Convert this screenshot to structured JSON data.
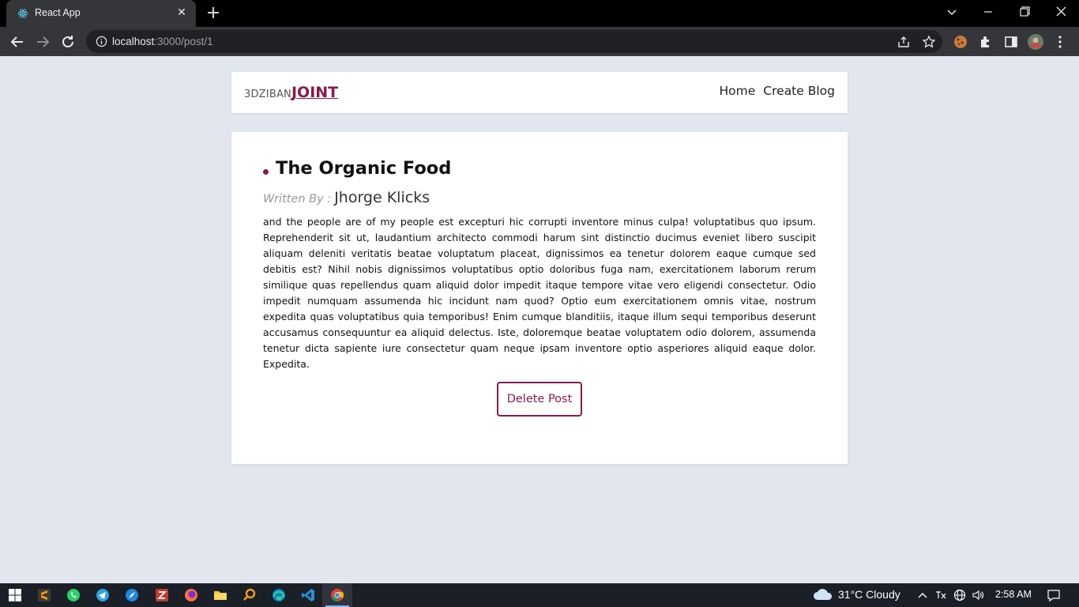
{
  "browser": {
    "tab_title": "React App",
    "url_host": "localhost",
    "url_path": ":3000/post/1"
  },
  "navbar": {
    "brand_prefix": "3DZIBAN",
    "brand_name": "JOINT",
    "links": [
      {
        "label": "Home"
      },
      {
        "label": "Create Blog"
      }
    ]
  },
  "post": {
    "title": "The Organic Food",
    "written_by_label": "Written By :",
    "author": "Jhorge Klicks",
    "body": "and the people are of my people est excepturi hic corrupti inventore minus culpa! voluptatibus quo ipsum. Reprehenderit sit ut, laudantium architecto commodi harum sint distinctio ducimus eveniet libero suscipit aliquam deleniti veritatis beatae voluptatum placeat, dignissimos ea tenetur dolorem eaque cumque sed debitis est? Nihil nobis dignissimos voluptatibus optio doloribus fuga nam, exercitationem laborum rerum similique quas repellendus quam aliquid dolor impedit itaque tempore vitae vero eligendi consectetur. Odio impedit numquam assumenda hic incidunt nam quod? Optio eum exercitationem omnis vitae, nostrum expedita quas voluptatibus quia temporibus! Enim cumque blanditiis, itaque illum sequi temporibus deserunt accusamus consequuntur ea aliquid delectus. Iste, doloremque beatae voluptatem odio dolorem, assumenda tenetur dicta sapiente iure consectetur quam neque ipsam inventore optio asperiores aliquid eaque dolor. Expedita.",
    "delete_label": "Delete Post"
  },
  "taskbar": {
    "weather": "31°C  Cloudy",
    "time": "2:58 AM"
  },
  "colors": {
    "accent": "#8a1a4a",
    "page_bg": "#e2e7ef"
  }
}
